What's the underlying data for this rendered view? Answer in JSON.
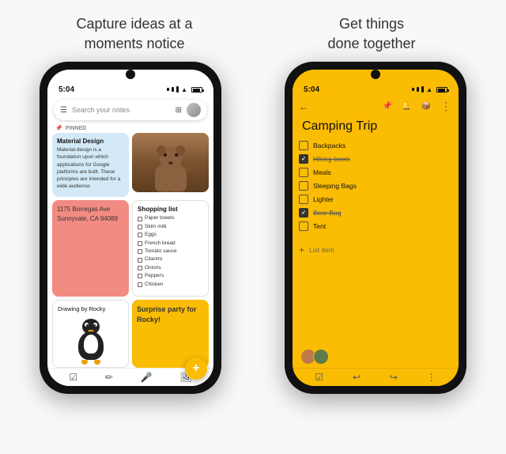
{
  "left_headline": "Capture ideas at a\nmoments notice",
  "right_headline": "Get things\ndone together",
  "left_phone": {
    "status_time": "5:04",
    "search_placeholder": "Search your notes",
    "pinned_label": "PINNED",
    "notes": [
      {
        "id": "material-design",
        "title": "Material Design",
        "body": "Material design is a foundation upon which applications for Google platforms are built. These principles are intended for a wide audience.",
        "color": "blue"
      },
      {
        "id": "dog-photo",
        "type": "image",
        "color": "image"
      },
      {
        "id": "address",
        "body": "1175 Borregas Ave Sunnyvale, CA 94089",
        "color": "salmon"
      },
      {
        "id": "shopping",
        "title": "Shopping list",
        "items": [
          "Paper towels",
          "Skim milk",
          "Eggs",
          "French bread",
          "Tomato sauce",
          "Cilantro",
          "Onions",
          "Peppers",
          "Chicken"
        ],
        "color": "white"
      },
      {
        "id": "drawing",
        "title": "Drawing by Rocky",
        "color": "drawing"
      },
      {
        "id": "surprise",
        "title": "Surprise party for Rocky!",
        "color": "yellow"
      }
    ],
    "fab_icon": "+",
    "bottom_nav": [
      "☰",
      "✏️",
      "🎤",
      "🖼"
    ]
  },
  "right_phone": {
    "status_time": "5:04",
    "back_icon": "←",
    "toolbar_icons": [
      "📌",
      "🔔",
      "📦"
    ],
    "note_title": "Camping Trip",
    "checklist": [
      {
        "label": "Backpacks",
        "checked": false
      },
      {
        "label": "Hiking boots",
        "checked": true
      },
      {
        "label": "Meals",
        "checked": false
      },
      {
        "label": "Sleeping Bags",
        "checked": false
      },
      {
        "label": "Lighter",
        "checked": false
      },
      {
        "label": "Bear Bag",
        "checked": true
      },
      {
        "label": "Tent",
        "checked": false
      }
    ],
    "add_item_label": "List item",
    "bottom_nav_icons": [
      "☑",
      "↩",
      "↪",
      "⋮"
    ]
  }
}
